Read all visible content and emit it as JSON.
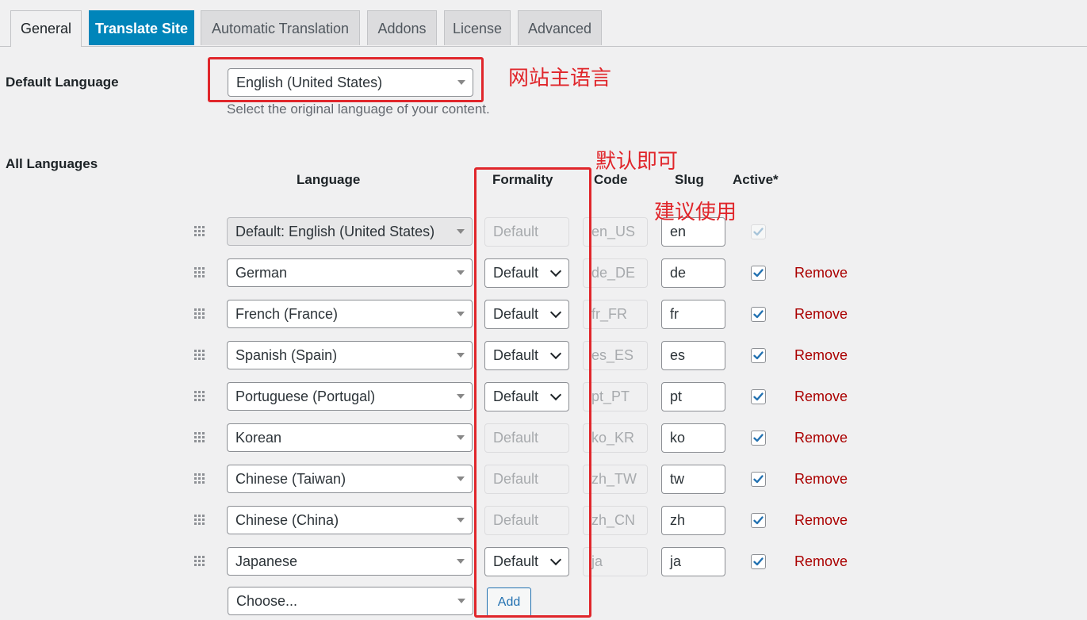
{
  "tabs": [
    {
      "label": "General"
    },
    {
      "label": "Translate Site"
    },
    {
      "label": "Automatic Translation"
    },
    {
      "label": "Addons"
    },
    {
      "label": "License"
    },
    {
      "label": "Advanced"
    }
  ],
  "default_language": {
    "label": "Default Language",
    "value": "English (United States)",
    "help": "Select the original language of your content."
  },
  "all_languages": {
    "label": "All Languages",
    "columns": {
      "language": "Language",
      "formality": "Formality",
      "code": "Code",
      "slug": "Slug",
      "active": "Active*"
    },
    "rows": [
      {
        "language": "Default: English (United States)",
        "formality": "Default",
        "code": "en_US",
        "slug": "en",
        "active": true
      },
      {
        "language": "German",
        "formality": "Default",
        "code": "de_DE",
        "slug": "de",
        "active": true,
        "remove": "Remove"
      },
      {
        "language": "French (France)",
        "formality": "Default",
        "code": "fr_FR",
        "slug": "fr",
        "active": true,
        "remove": "Remove"
      },
      {
        "language": "Spanish (Spain)",
        "formality": "Default",
        "code": "es_ES",
        "slug": "es",
        "active": true,
        "remove": "Remove"
      },
      {
        "language": "Portuguese (Portugal)",
        "formality": "Default",
        "code": "pt_PT",
        "slug": "pt",
        "active": true,
        "remove": "Remove"
      },
      {
        "language": "Korean",
        "formality": "Default",
        "code": "ko_KR",
        "slug": "ko",
        "active": true,
        "remove": "Remove"
      },
      {
        "language": "Chinese (Taiwan)",
        "formality": "Default",
        "code": "zh_TW",
        "slug": "tw",
        "active": true,
        "remove": "Remove"
      },
      {
        "language": "Chinese (China)",
        "formality": "Default",
        "code": "zh_CN",
        "slug": "zh",
        "active": true,
        "remove": "Remove"
      },
      {
        "language": "Japanese",
        "formality": "Default",
        "code": "ja",
        "slug": "ja",
        "active": true,
        "remove": "Remove"
      }
    ],
    "choose_placeholder": "Choose...",
    "add_label": "Add"
  },
  "annotations": {
    "main_language": "网站主语言",
    "keep_default": "默认即可",
    "recommended": "建议使用"
  },
  "colors": {
    "accent": "#0085ba",
    "annotation": "#e0262b",
    "remove": "#aa0000"
  },
  "icons": {
    "handle": "drag-handle-icon",
    "check": "checkmark-icon",
    "caret": "caret-down-icon"
  }
}
